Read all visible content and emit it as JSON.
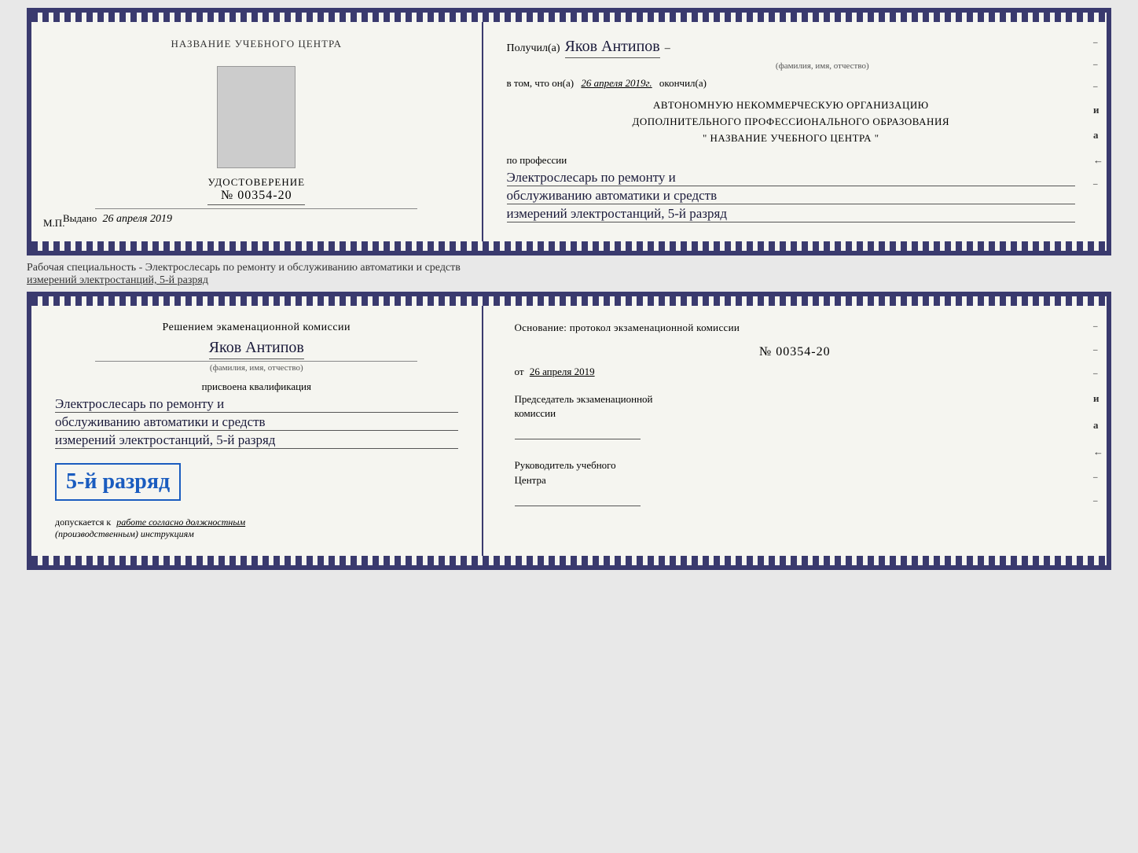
{
  "top_doc": {
    "left": {
      "training_center_label": "НАЗВАНИЕ УЧЕБНОГО ЦЕНТРА",
      "cert_label": "УДОСТОВЕРЕНИЕ",
      "cert_number": "№ 00354-20",
      "issued_label": "Выдано",
      "issued_date": "26 апреля 2019",
      "mp_label": "М.П."
    },
    "right": {
      "received_prefix": "Получил(а)",
      "recipient_name": "Яков Антипов",
      "fio_label": "(фамилия, имя, отчество)",
      "in_that_prefix": "в том, что он(а)",
      "date_completed": "26 апреля 2019г.",
      "finished_label": "окончил(а)",
      "org_line1": "АВТОНОМНУЮ НЕКОММЕРЧЕСКУЮ ОРГАНИЗАЦИЮ",
      "org_line2": "ДОПОЛНИТЕЛЬНОГО ПРОФЕССИОНАЛЬНОГО ОБРАЗОВАНИЯ",
      "org_quote1": "\"",
      "org_name": "НАЗВАНИЕ УЧЕБНОГО ЦЕНТРА",
      "org_quote2": "\"",
      "profession_prefix": "по профессии",
      "profession_line1": "Электрослесарь по ремонту и",
      "profession_line2": "обслуживанию автоматики и средств",
      "profession_line3": "измерений электростанций, 5-й разряд"
    },
    "side_chars": [
      "и",
      "а",
      "←",
      "–",
      "–",
      "–",
      "–"
    ]
  },
  "between_text": {
    "line1": "Рабочая специальность - Электрослесарь по ремонту и обслуживанию автоматики и средств",
    "line2": "измерений электростанций, 5-й разряд"
  },
  "bottom_doc": {
    "left": {
      "commission_text": "Решением экаменационной комиссии",
      "person_name": "Яков Антипов",
      "fio_label": "(фамилия, имя, отчество)",
      "qualification_prefix": "присвоена квалификация",
      "qual_line1": "Электрослесарь по ремонту и",
      "qual_line2": "обслуживанию автоматики и средств",
      "qual_line3": "измерений электростанций, 5-й разряд",
      "grade_label": "5-й разряд",
      "допускается_prefix": "допускается к",
      "допускается_text": "работе согласно должностным",
      "допускается_text2": "(производственным) инструкциям"
    },
    "right": {
      "foundation_label": "Основание: протокол экзаменационной комиссии",
      "protocol_number": "№ 00354-20",
      "from_label": "от",
      "from_date": "26 апреля 2019",
      "chairman_title": "Председатель экзаменационной",
      "chairman_title2": "комиссии",
      "manager_title": "Руководитель учебного",
      "manager_title2": "Центра"
    },
    "side_chars": [
      "и",
      "а",
      "←",
      "–",
      "–",
      "–",
      "–",
      "–"
    ]
  }
}
